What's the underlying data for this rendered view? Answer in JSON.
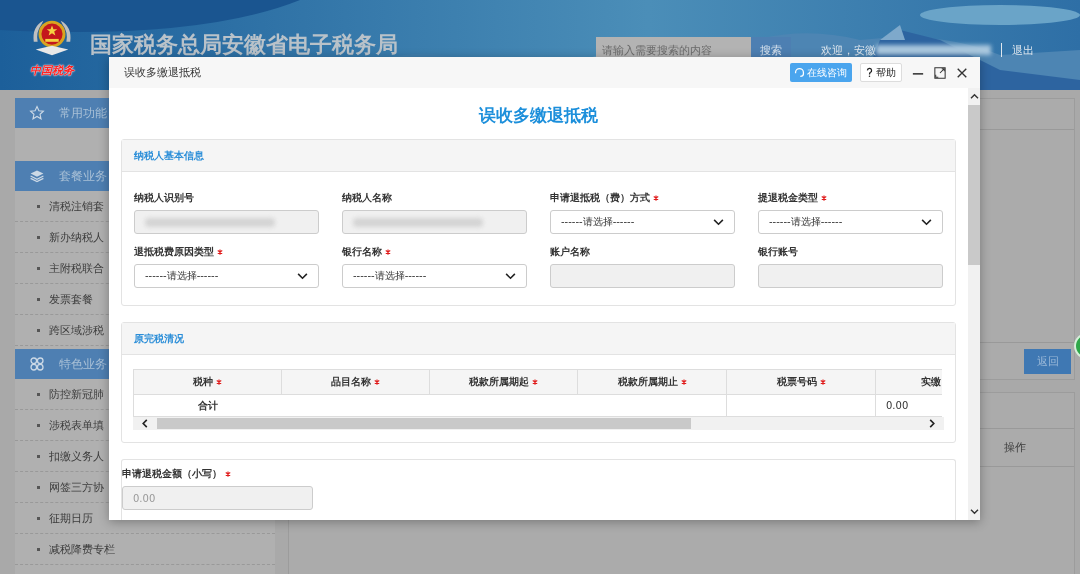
{
  "header": {
    "logo_caption": "中国税务",
    "title": "国家税务总局安徽省电子税务局",
    "search": {
      "placeholder": "请输入需要搜索的内容",
      "button": "搜索"
    },
    "welcome": "欢迎，安徽",
    "welcome_redacted": true,
    "logout": "退出"
  },
  "sidebar": {
    "sections": [
      {
        "title": "常用功能"
      },
      {
        "title": "套餐业务",
        "items": [
          "清税注销套",
          "新办纳税人",
          "主附税联合",
          "发票套餐",
          "跨区域涉税"
        ]
      },
      {
        "title": "特色业务",
        "items": [
          "防控新冠肺",
          "涉税表单填",
          "扣缴义务人",
          "网签三方协",
          "征期日历",
          "减税降费专栏"
        ]
      }
    ]
  },
  "main": {
    "back_button": "返回",
    "table_header": "操作"
  },
  "dialog": {
    "title": "误收多缴退抵税",
    "buttons": [
      {
        "label": "在线咨询",
        "kind": "consult"
      },
      {
        "label": "帮助",
        "kind": "help"
      }
    ],
    "heading": "误收多缴退抵税",
    "basic_info": {
      "title": "纳税人基本信息",
      "fields": [
        {
          "label": "纳税人识别号",
          "required": false,
          "kind": "input",
          "disabled": true,
          "redacted": true
        },
        {
          "label": "纳税人名称",
          "required": false,
          "kind": "input",
          "disabled": true,
          "redacted": true
        },
        {
          "label": "申请退抵税（费）方式",
          "required": true,
          "kind": "select",
          "value": "------请选择------"
        },
        {
          "label": "提退税金类型",
          "required": true,
          "kind": "select",
          "value": "------请选择------"
        },
        {
          "label": "退抵税费原因类型",
          "required": true,
          "kind": "select",
          "value": "------请选择------"
        },
        {
          "label": "银行名称",
          "required": true,
          "kind": "select",
          "value": "------请选择------"
        },
        {
          "label": "账户名称",
          "required": false,
          "kind": "input",
          "disabled": true
        },
        {
          "label": "银行账号",
          "required": false,
          "kind": "input",
          "disabled": true
        }
      ]
    },
    "tax_paid": {
      "title": "原完税清况",
      "columns": [
        {
          "label": "税种",
          "required": true
        },
        {
          "label": "品目名称",
          "required": true
        },
        {
          "label": "税款所属期起",
          "required": true
        },
        {
          "label": "税款所属期止",
          "required": true
        },
        {
          "label": "税票号码",
          "required": true
        },
        {
          "label": "实缴",
          "required": false
        }
      ],
      "rows": [
        {
          "cells": [
            "合计",
            "",
            "",
            "",
            "",
            "0.00"
          ]
        }
      ]
    },
    "refund_amount": {
      "label": "申请退税金额（小写）",
      "required": true,
      "placeholder": "0.00",
      "disabled": true
    }
  }
}
